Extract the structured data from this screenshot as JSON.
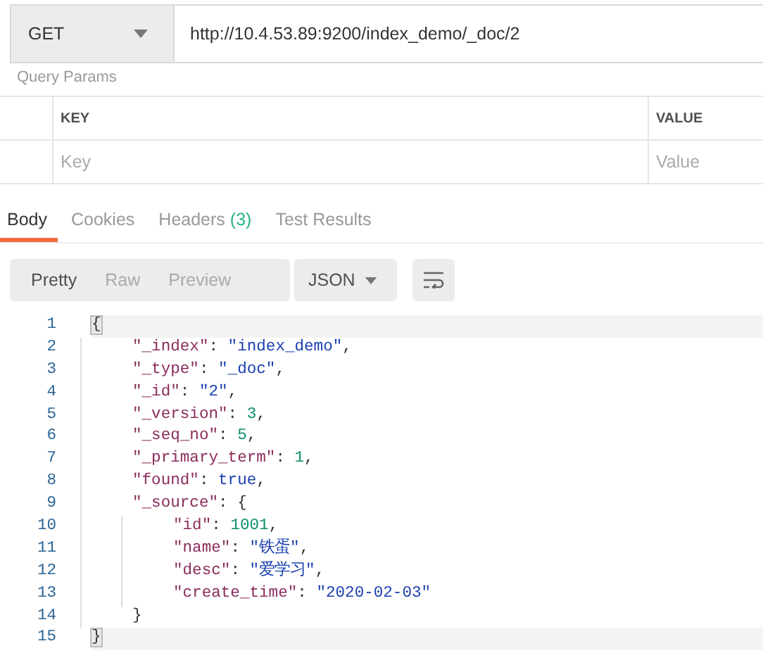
{
  "request": {
    "method": "GET",
    "url": "http://10.4.53.89:9200/index_demo/_doc/2"
  },
  "query_params": {
    "title": "Query Params",
    "columns": [
      "KEY",
      "VALUE"
    ],
    "placeholders": [
      "Key",
      "Value"
    ]
  },
  "response_tabs": [
    {
      "label": "Body",
      "selected": true
    },
    {
      "label": "Cookies",
      "selected": false
    },
    {
      "label": "Headers",
      "count": "(3)",
      "selected": false
    },
    {
      "label": "Test Results",
      "selected": false
    }
  ],
  "view_modes": [
    {
      "label": "Pretty",
      "selected": true
    },
    {
      "label": "Raw",
      "selected": false
    },
    {
      "label": "Preview",
      "selected": false
    }
  ],
  "format": "JSON",
  "code": [
    {
      "number": "1",
      "highlighted": true,
      "tokens": [
        {
          "kind": "brace",
          "text": "{"
        }
      ],
      "children": [
        {
          "number": "2",
          "tokens": [
            {
              "kind": "key",
              "text": "\"_index\""
            },
            {
              "kind": "punct",
              "text": ": "
            },
            {
              "kind": "string",
              "text": "\"index_demo\""
            },
            {
              "kind": "punct",
              "text": ","
            }
          ]
        },
        {
          "number": "3",
          "tokens": [
            {
              "kind": "key",
              "text": "\"_type\""
            },
            {
              "kind": "punct",
              "text": ": "
            },
            {
              "kind": "string",
              "text": "\"_doc\""
            },
            {
              "kind": "punct",
              "text": ","
            }
          ]
        },
        {
          "number": "4",
          "tokens": [
            {
              "kind": "key",
              "text": "\"_id\""
            },
            {
              "kind": "punct",
              "text": ": "
            },
            {
              "kind": "string",
              "text": "\"2\""
            },
            {
              "kind": "punct",
              "text": ","
            }
          ]
        },
        {
          "number": "5",
          "tokens": [
            {
              "kind": "key",
              "text": "\"_version\""
            },
            {
              "kind": "punct",
              "text": ": "
            },
            {
              "kind": "number",
              "text": "3"
            },
            {
              "kind": "punct",
              "text": ","
            }
          ]
        },
        {
          "number": "6",
          "tokens": [
            {
              "kind": "key",
              "text": "\"_seq_no\""
            },
            {
              "kind": "punct",
              "text": ": "
            },
            {
              "kind": "number",
              "text": "5"
            },
            {
              "kind": "punct",
              "text": ","
            }
          ]
        },
        {
          "number": "7",
          "tokens": [
            {
              "kind": "key",
              "text": "\"_primary_term\""
            },
            {
              "kind": "punct",
              "text": ": "
            },
            {
              "kind": "number",
              "text": "1"
            },
            {
              "kind": "punct",
              "text": ","
            }
          ]
        },
        {
          "number": "8",
          "tokens": [
            {
              "kind": "key",
              "text": "\"found\""
            },
            {
              "kind": "punct",
              "text": ": "
            },
            {
              "kind": "literal",
              "text": "true"
            },
            {
              "kind": "punct",
              "text": ","
            }
          ]
        },
        {
          "number": "9",
          "tokens": [
            {
              "kind": "key",
              "text": "\"_source\""
            },
            {
              "kind": "punct",
              "text": ": {"
            }
          ],
          "children": [
            {
              "number": "10",
              "tokens": [
                {
                  "kind": "key",
                  "text": "\"id\""
                },
                {
                  "kind": "punct",
                  "text": ": "
                },
                {
                  "kind": "number",
                  "text": "1001"
                },
                {
                  "kind": "punct",
                  "text": ","
                }
              ]
            },
            {
              "number": "11",
              "tokens": [
                {
                  "kind": "key",
                  "text": "\"name\""
                },
                {
                  "kind": "punct",
                  "text": ": "
                },
                {
                  "kind": "string",
                  "text": "\"铁蛋\""
                },
                {
                  "kind": "punct",
                  "text": ","
                }
              ]
            },
            {
              "number": "12",
              "tokens": [
                {
                  "kind": "key",
                  "text": "\"desc\""
                },
                {
                  "kind": "punct",
                  "text": ": "
                },
                {
                  "kind": "string",
                  "text": "\"爱学习\""
                },
                {
                  "kind": "punct",
                  "text": ","
                }
              ]
            },
            {
              "number": "13",
              "tokens": [
                {
                  "kind": "key",
                  "text": "\"create_time\""
                },
                {
                  "kind": "punct",
                  "text": ": "
                },
                {
                  "kind": "string",
                  "text": "\"2020-02-03\""
                }
              ]
            }
          ]
        },
        {
          "number": "14",
          "tokens": [
            {
              "kind": "punct",
              "text": "}"
            }
          ]
        }
      ]
    },
    {
      "number": "15",
      "highlighted": true,
      "tokens": [
        {
          "kind": "brace",
          "text": "}"
        }
      ]
    }
  ]
}
